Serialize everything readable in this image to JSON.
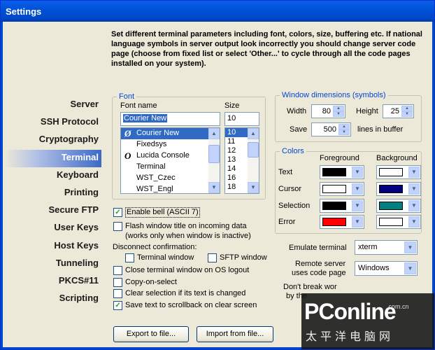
{
  "window": {
    "title": "Settings"
  },
  "description": "Set different terminal parameters including font, colors, size, buffering etc. If national language symbols in server output look incorrectly you should change server code page (choose from fixed list or select 'Other...' to cycle through all the code pages installed on your system).",
  "nav": {
    "items": [
      "Server",
      "SSH Protocol",
      "Cryptography",
      "Terminal",
      "Keyboard",
      "Printing",
      "Secure FTP",
      "User Keys",
      "Host Keys",
      "Tunneling",
      "PKCS#11",
      "Scripting"
    ],
    "active": "Terminal"
  },
  "font": {
    "legend": "Font",
    "name_label": "Font name",
    "size_label": "Size",
    "name_value": "Courier New",
    "size_value": "10",
    "fonts": [
      "Courier New",
      "Fixedsys",
      "Lucida Console",
      "Terminal",
      "WST_Czec",
      "WST_Engl"
    ],
    "sizes": [
      "10",
      "11",
      "12",
      "13",
      "14",
      "16",
      "18"
    ]
  },
  "window_dims": {
    "legend": "Window dimensions (symbols)",
    "width_label": "Width",
    "width_value": "80",
    "height_label": "Height",
    "height_value": "25",
    "save_label": "Save",
    "save_value": "500",
    "buffer_label": "lines in buffer"
  },
  "colors": {
    "legend": "Colors",
    "fg_header": "Foreground",
    "bg_header": "Background",
    "rows": [
      {
        "label": "Text",
        "fg": "#000000",
        "bg": "#ffffff"
      },
      {
        "label": "Cursor",
        "fg": "#ffffff",
        "bg": "#000080"
      },
      {
        "label": "Selection",
        "fg": "#000000",
        "bg": "#008080"
      },
      {
        "label": "Error",
        "fg": "#ff0000",
        "bg": "#ffffff"
      }
    ]
  },
  "options": {
    "enable_bell": "Enable bell (ASCII 7)",
    "flash_title": "Flash window title on incoming data",
    "flash_title_note": "(works only when window is inactive)",
    "disconnect_label": "Disconnect confirmation:",
    "terminal_window": "Terminal window",
    "sftp_window": "SFTP window",
    "close_on_logout": "Close terminal window on OS logout",
    "copy_on_select": "Copy-on-select",
    "clear_selection": "Clear selection if its text is changed",
    "save_text": "Save text to scrollback on clear screen"
  },
  "emulation": {
    "emulate_label": "Emulate terminal",
    "emulate_value": "xterm",
    "codepage_label_1": "Remote server",
    "codepage_label_2": "uses code page",
    "codepage_value": "Windows",
    "dont_break_1": "Don't break wor",
    "dont_break_2": "by the"
  },
  "buttons": {
    "export": "Export to file...",
    "import": "Import from file..."
  },
  "watermark": {
    "main": "PConline",
    "domain": ".com.cn",
    "sub": "太平洋电脑网"
  }
}
